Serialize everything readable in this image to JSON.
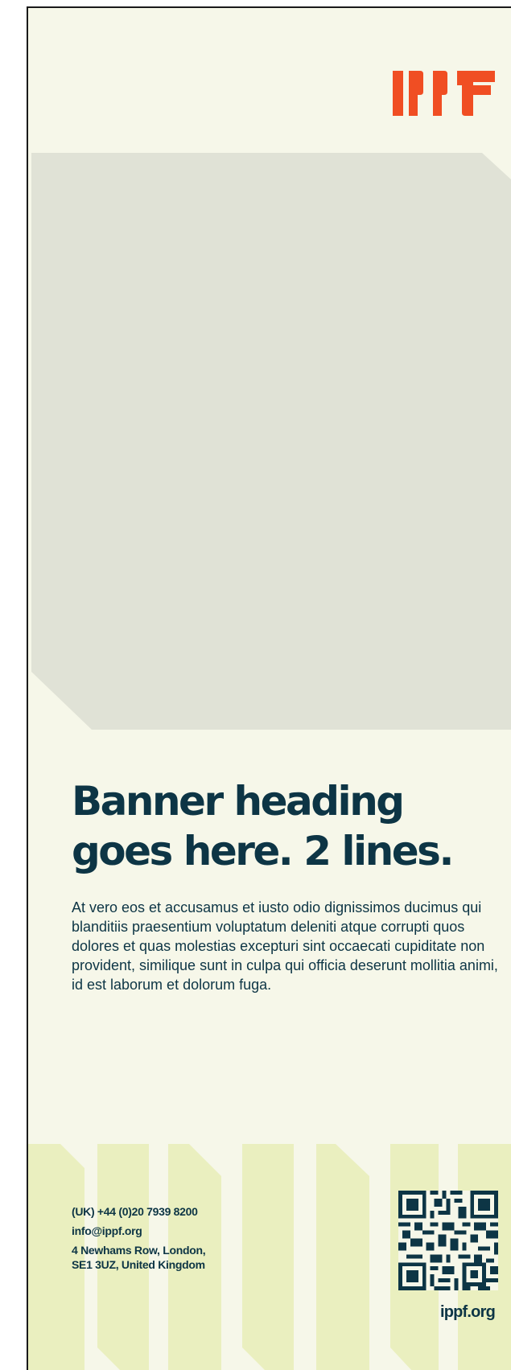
{
  "brand": {
    "logo_text": "IPPF",
    "accent_color": "#f04e23",
    "ink_color": "#0d3545",
    "background_color": "#f6f7e9",
    "placeholder_color": "#e0e2d6",
    "stripe_color": "#eaefbf"
  },
  "banner": {
    "heading": "Banner heading goes here. 2 lines.",
    "body": "At vero eos et accusamus et iusto odio dignissimos ducimus qui blanditiis praesentium voluptatum deleniti atque corrupti quos dolores et quas molestias excepturi sint occaecati cupiditate non provident, similique sunt in culpa qui officia deserunt mollitia animi, id est laborum et dolorum fuga."
  },
  "contact": {
    "phone": "(UK) +44 (0)20 7939 8200",
    "email": "info@ippf.org",
    "address_line1": "4 Newhams Row, London,",
    "address_line2": "SE1 3UZ, United Kingdom"
  },
  "footer": {
    "website": "ippf.org",
    "qr_icon": "qr-code-icon"
  }
}
